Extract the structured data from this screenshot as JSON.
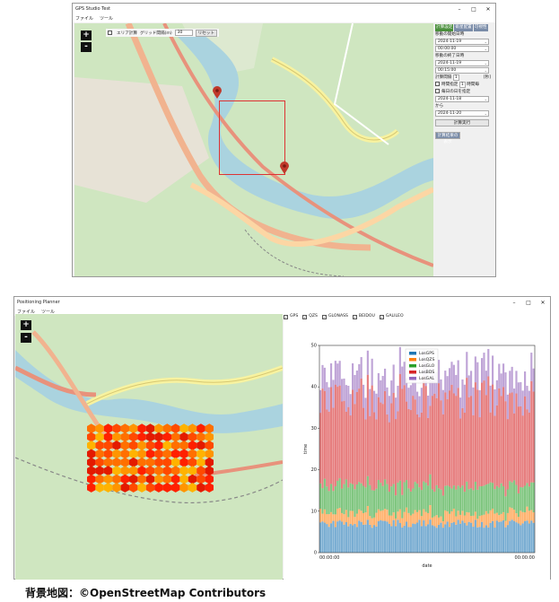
{
  "top_window": {
    "title": "GPS Studio Test",
    "menu": [
      "ファイル",
      "ツール"
    ],
    "controls": [
      "–",
      "□",
      "✕"
    ],
    "map_toolbar": {
      "checkbox_label": "エリア計算",
      "interval_label": "グリッド間隔(m)",
      "interval_value": "30",
      "reset_label": "リセット"
    },
    "zoom_in": "+",
    "zoom_out": "-",
    "panel": {
      "tabs": [
        "計算設定",
        "衛星配置",
        "可視性"
      ],
      "start_date_label": "移動の開始日時",
      "start_date": "2024-11-19",
      "start_time": "00:00:00",
      "end_date_label": "移動の終了日時",
      "end_date": "2024-11-19",
      "end_time": "00:15:00",
      "calc_interval_label": "計算間隔",
      "calc_interval_value": "1",
      "calc_interval_unit": "[秒]",
      "time_spec_label": "時間指定",
      "time_spec_value": "1",
      "time_spec_unit": "時間毎",
      "daily_label": "毎日の日を指定",
      "from_date": "2024-11-18",
      "to_label": "から",
      "to_date": "2024-11-20",
      "run_button": "計算実行",
      "result_button": "計算結果の表示"
    },
    "map_labels": [
      "地点",
      "計算範囲"
    ]
  },
  "bottom_window": {
    "title": "Positioning Planner",
    "menu": [
      "ファイル",
      "ツール"
    ],
    "controls": [
      "–",
      "□",
      "✕"
    ],
    "zoom_in": "+",
    "zoom_out": "-",
    "gnss_filters": [
      {
        "label": "GPS",
        "checked": true
      },
      {
        "label": "QZS",
        "checked": true
      },
      {
        "label": "GLONASS",
        "checked": true
      },
      {
        "label": "BEIDOU",
        "checked": true
      },
      {
        "label": "GALILEO",
        "checked": true
      }
    ]
  },
  "chart_data": {
    "type": "bar",
    "stacked": true,
    "xlabel": "date",
    "ylabel": "time",
    "x_tick_labels": [
      "00:00:00",
      "00:00:00"
    ],
    "ylim": [
      0,
      50
    ],
    "y_ticks": [
      0,
      10,
      20,
      30,
      40,
      50
    ],
    "legend_position": "top-center",
    "bar_count": 100,
    "series": [
      {
        "name": "LosGPS",
        "color": "#1f77b4",
        "mean": 7
      },
      {
        "name": "LosQZS",
        "color": "#ff7f0e",
        "mean": 2.5
      },
      {
        "name": "LosGLO",
        "color": "#2ca02c",
        "mean": 6.5
      },
      {
        "name": "LosBDS",
        "color": "#d62728",
        "mean": 21
      },
      {
        "name": "LosGAL",
        "color": "#9467bd",
        "mean": 6
      }
    ]
  },
  "caption": "背景地図：©OpenStreetMap Contributors"
}
